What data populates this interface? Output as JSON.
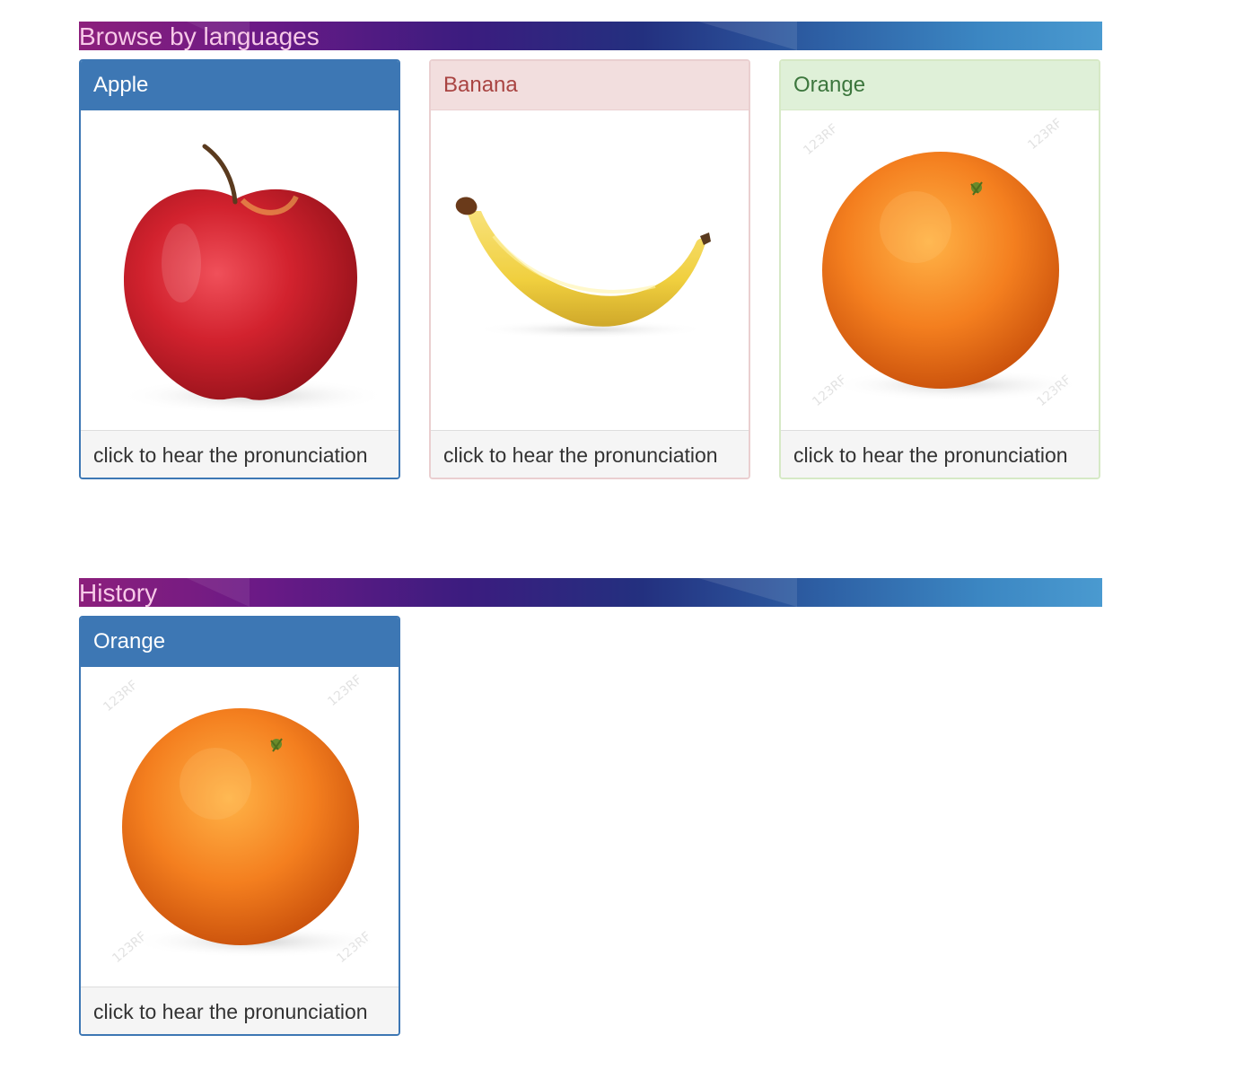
{
  "browse": {
    "heading": "Browse by languages",
    "cards": [
      {
        "name": "Apple",
        "caption": "click to hear the pronunciation",
        "style": "primary",
        "image": "apple"
      },
      {
        "name": "Banana",
        "caption": "click to hear the pronunciation",
        "style": "danger",
        "image": "banana"
      },
      {
        "name": "Orange",
        "caption": "click to hear the pronunciation",
        "style": "success",
        "image": "orange"
      }
    ]
  },
  "history": {
    "heading": "History",
    "cards": [
      {
        "name": "Orange",
        "caption": "click to hear the pronunciation",
        "style": "primary",
        "image": "orange"
      }
    ]
  },
  "colors": {
    "primary": "#3d77b4",
    "danger_text": "#a94442",
    "success_text": "#3c763d",
    "banner_title": "#f7c9e8"
  }
}
